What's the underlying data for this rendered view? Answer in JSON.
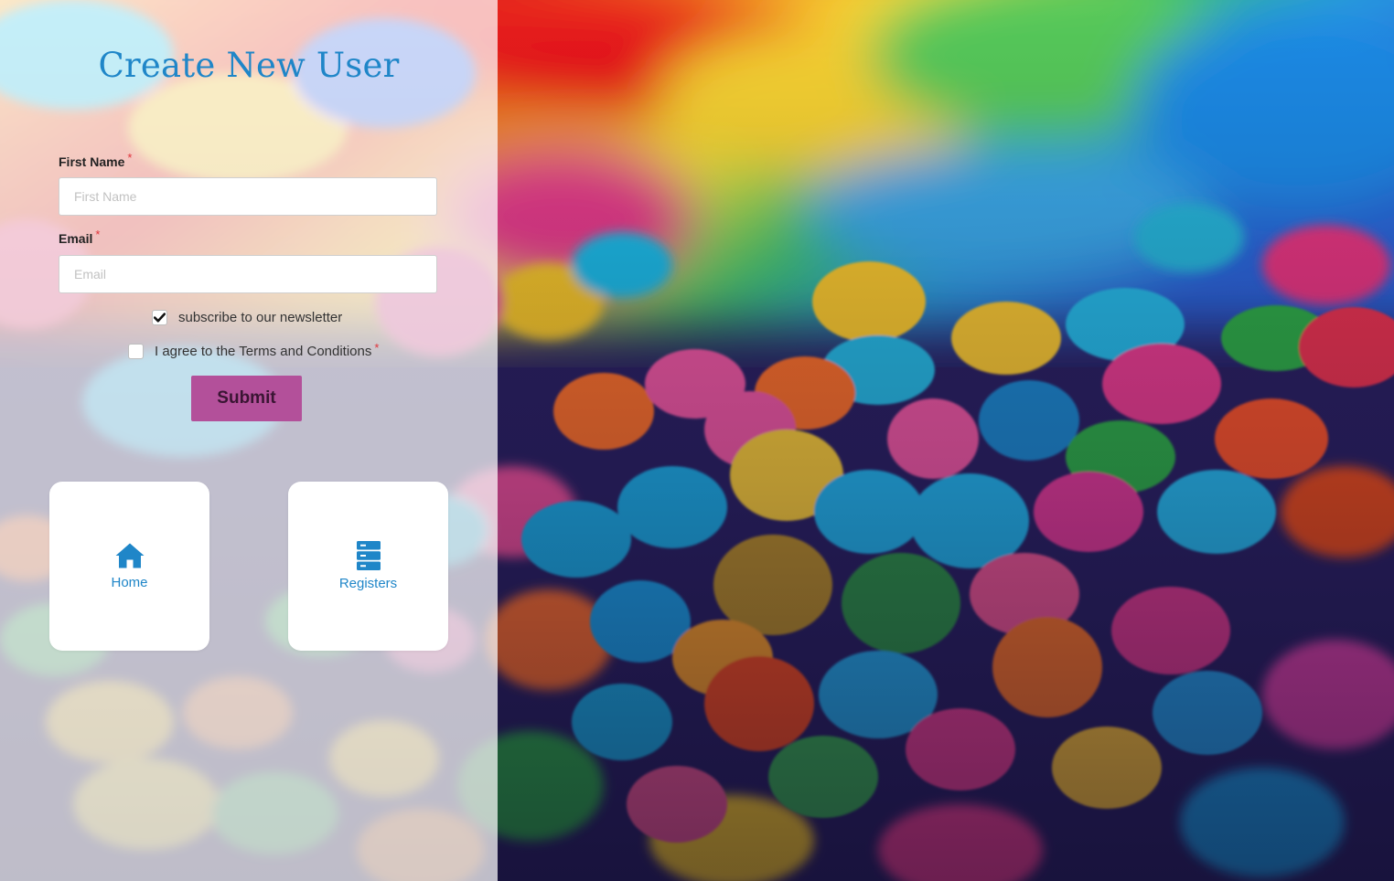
{
  "form": {
    "title": "Create New User",
    "required_marker": "*",
    "first_name": {
      "label": "First Name",
      "placeholder": "First Name",
      "value": ""
    },
    "email": {
      "label": "Email",
      "placeholder": "Email",
      "value": ""
    },
    "newsletter": {
      "label": "subscribe to our newsletter",
      "checked": true
    },
    "terms": {
      "label": "I agree to the Terms and Conditions",
      "checked": false
    },
    "submit_label": "Submit"
  },
  "nav_cards": [
    {
      "label": "Home",
      "icon": "home-icon"
    },
    {
      "label": "Registers",
      "icon": "server-stack-icon"
    }
  ],
  "colors": {
    "title": "#1f86c8",
    "submit_button": "#b3509a",
    "required": "#e0353b",
    "card_text": "#1f86c8"
  }
}
